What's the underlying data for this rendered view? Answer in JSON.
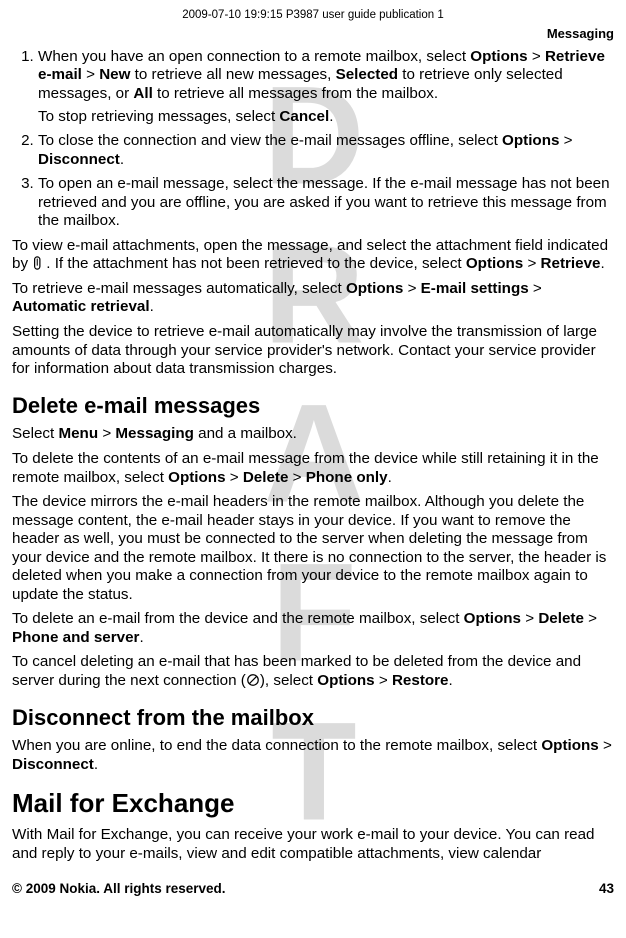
{
  "meta": {
    "header": "2009-07-10 19:9:15 P3987 user guide publication 1"
  },
  "watermark": "DRAFT",
  "section_label": "Messaging",
  "steps": {
    "i1": {
      "t1": "When you have an open connection to a remote mailbox, select ",
      "b1": "Options",
      "s1": " > ",
      "b2": "Retrieve e-mail",
      "s2": " > ",
      "b3": "New",
      "t2": " to retrieve all new messages, ",
      "b4": "Selected",
      "t3": " to retrieve only selected messages, or ",
      "b5": "All",
      "t4": " to retrieve all messages from the mailbox.",
      "sub_t1": "To stop retrieving messages, select ",
      "sub_b1": "Cancel",
      "sub_t2": "."
    },
    "i2": {
      "t1": "To close the connection and view the e-mail messages offline, select ",
      "b1": "Options",
      "s1": " > ",
      "b2": "Disconnect",
      "t2": "."
    },
    "i3": {
      "t1": "To open an e-mail message, select the message. If the e-mail message has not been retrieved and you are offline, you are asked if you want to retrieve this message from the mailbox."
    }
  },
  "p_attach": {
    "t1": "To view e-mail attachments, open the message, and select the attachment field indicated by ",
    "t2": ". If the attachment has not been retrieved to the device, select ",
    "b1": "Options",
    "s1": " > ",
    "b2": "Retrieve",
    "t3": "."
  },
  "p_auto": {
    "t1": "To retrieve e-mail messages automatically, select ",
    "b1": "Options",
    "s1": " > ",
    "b2": "E-mail settings",
    "s2": " > ",
    "b3": "Automatic retrieval",
    "t2": "."
  },
  "p_auto_note": "Setting the device to retrieve e-mail automatically may involve the transmission of large amounts of data through your service provider's network. Contact your service provider for information about data transmission charges.",
  "h_delete": "Delete e-mail messages",
  "p_del1": {
    "t1": "Select ",
    "b1": "Menu",
    "s1": " > ",
    "b2": "Messaging",
    "t2": " and a mailbox."
  },
  "p_del2": {
    "t1": "To delete the contents of an e-mail message from the device while still retaining it in the remote mailbox, select ",
    "b1": "Options",
    "s1": " > ",
    "b2": "Delete",
    "s2": " > ",
    "b3": "Phone only",
    "t2": "."
  },
  "p_del3": "The device mirrors the e-mail headers in the remote mailbox. Although you delete the message content, the e-mail header stays in your device. If you want to remove the header as well, you must be connected to the server when deleting the message from your device and the remote mailbox. It there is no connection to the server, the header is deleted when you make a connection from your device to the remote mailbox again to update the status.",
  "p_del4": {
    "t1": "To delete an e-mail from the device and the remote mailbox, select ",
    "b1": "Options",
    "s1": " > ",
    "b2": "Delete",
    "s2": " > ",
    "b3": "Phone and server",
    "t2": "."
  },
  "p_del5": {
    "t1": "To cancel deleting an e-mail that has been marked to be deleted from the device and server during the next connection (",
    "t2": "), select ",
    "b1": "Options",
    "s1": " > ",
    "b2": "Restore",
    "t3": "."
  },
  "h_disc": "Disconnect from the mailbox",
  "p_disc": {
    "t1": "When you are online, to end the data connection to the remote mailbox, select ",
    "b1": "Options",
    "s1": " > ",
    "b2": "Disconnect",
    "t2": "."
  },
  "h_mfe": "Mail for Exchange",
  "p_mfe": "With Mail for Exchange, you can receive your work e-mail to your device. You can read and reply to your e-mails, view and edit compatible attachments, view calendar",
  "footer": {
    "copyright": "© 2009 Nokia. All rights reserved.",
    "page": "43"
  }
}
